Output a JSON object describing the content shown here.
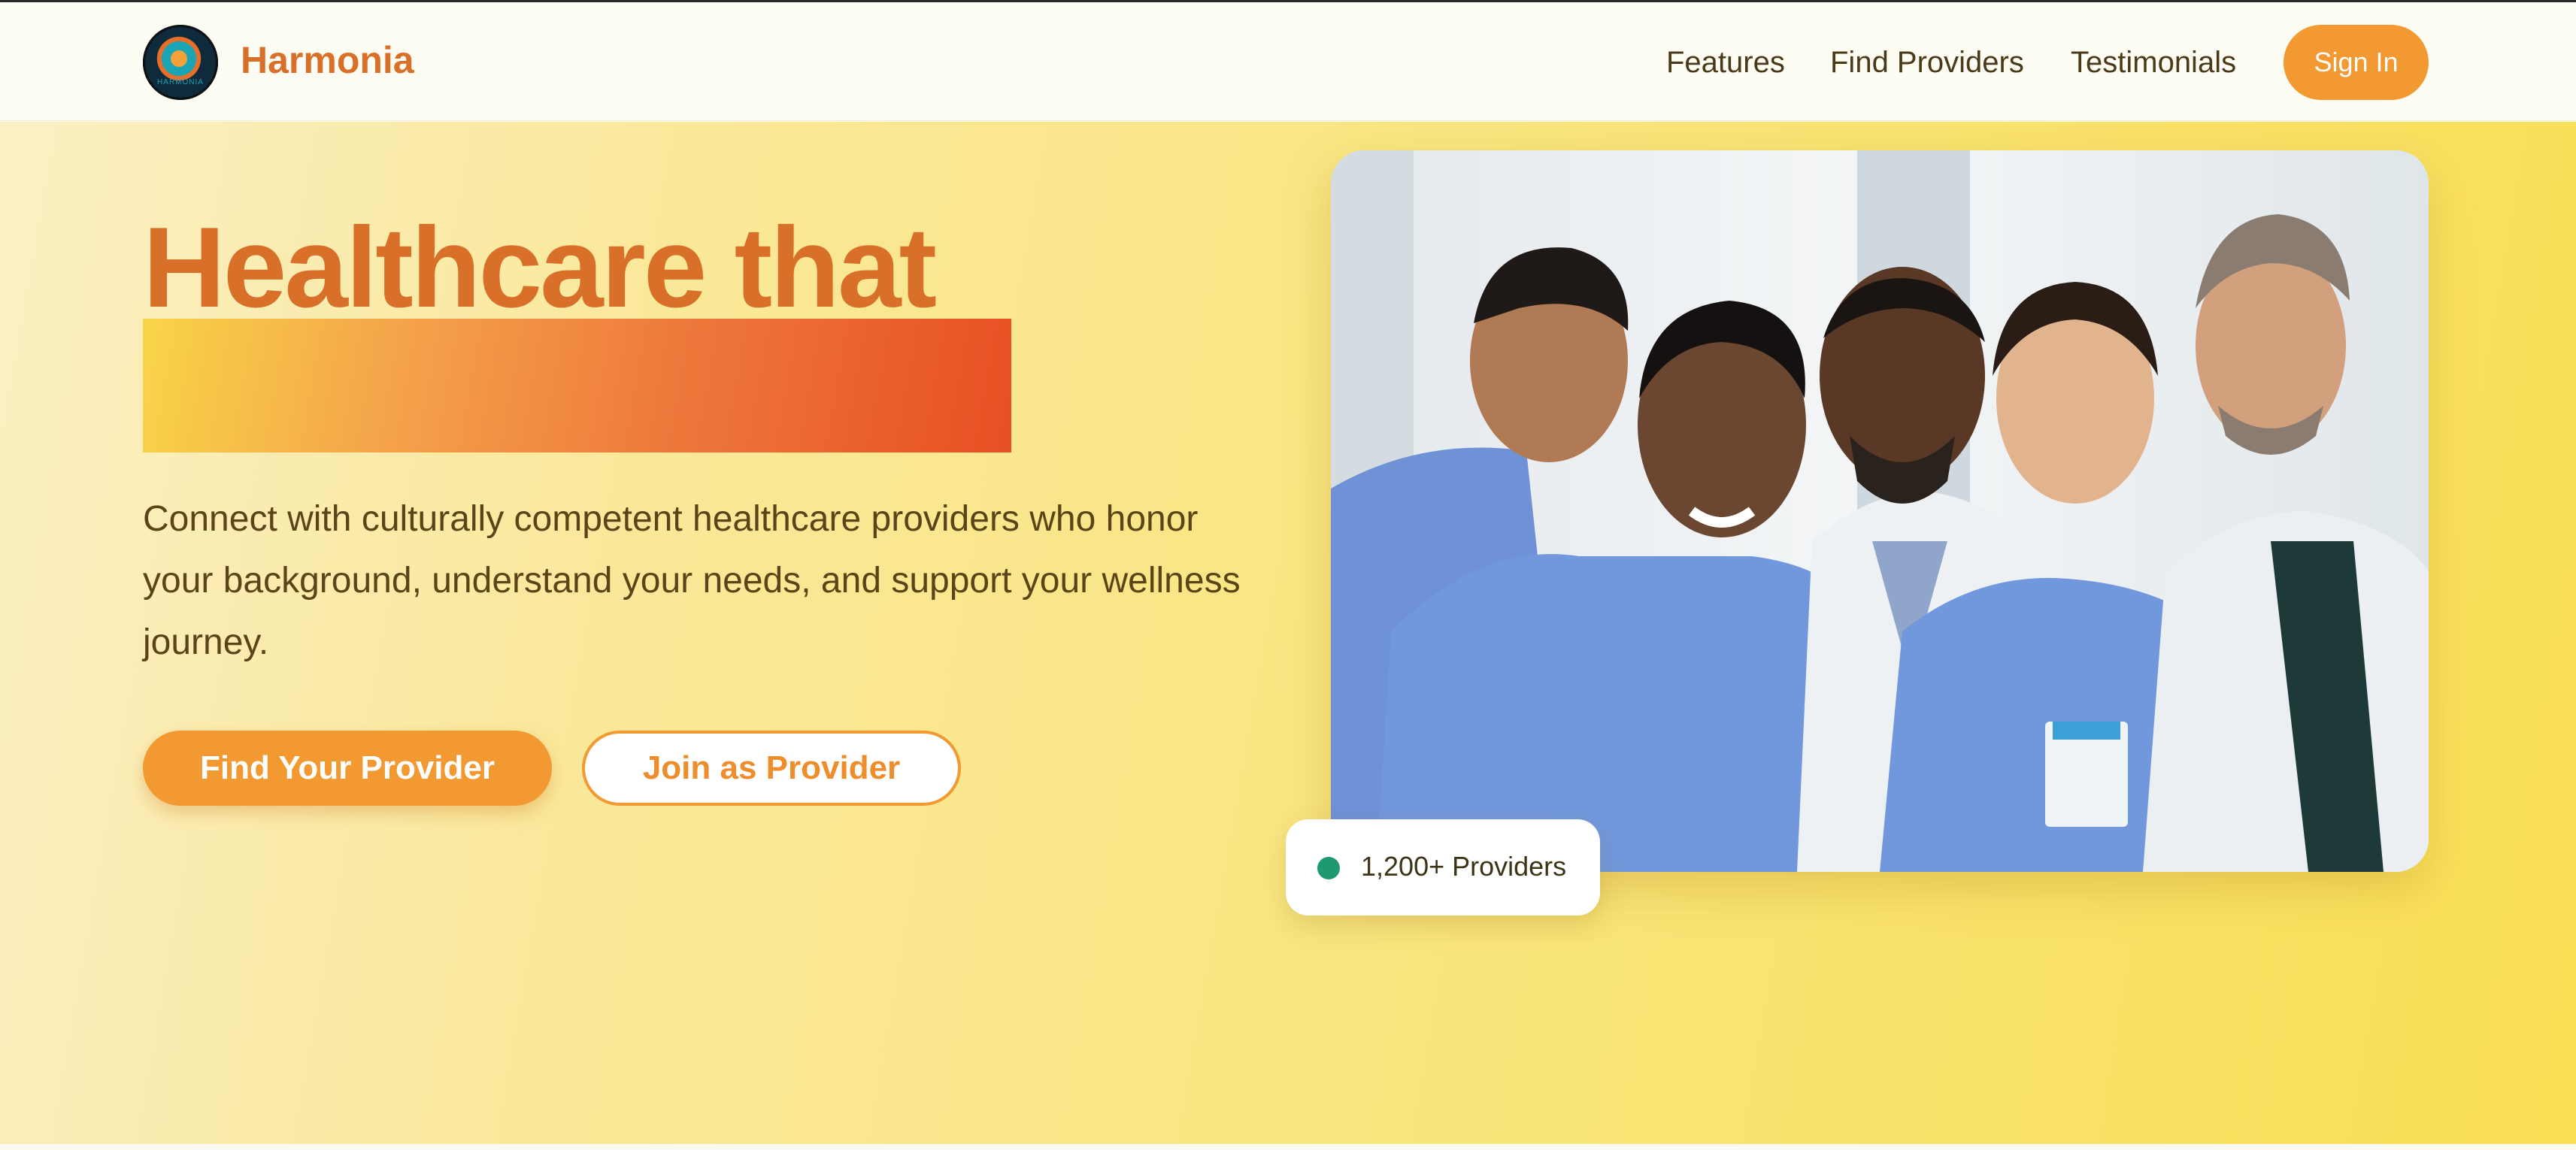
{
  "header": {
    "brand": "Harmonia",
    "logo_text": "HARMONIA",
    "nav": [
      "Features",
      "Find Providers",
      "Testimonials"
    ],
    "sign_in": "Sign In"
  },
  "hero": {
    "headline": "Healthcare that",
    "paragraph": "Connect with culturally competent healthcare providers who honor your background, understand your needs, and support your wellness journey.",
    "primary_button": "Find Your Provider",
    "secondary_button": "Join as Provider",
    "badge": "1,200+ Providers"
  },
  "colors": {
    "brand": "#d9702a",
    "button": "#f29a31",
    "badge_dot": "#1f9a6e"
  },
  "icons": {
    "logo": "harmonia-logo-icon",
    "badge": "status-dot-icon"
  }
}
